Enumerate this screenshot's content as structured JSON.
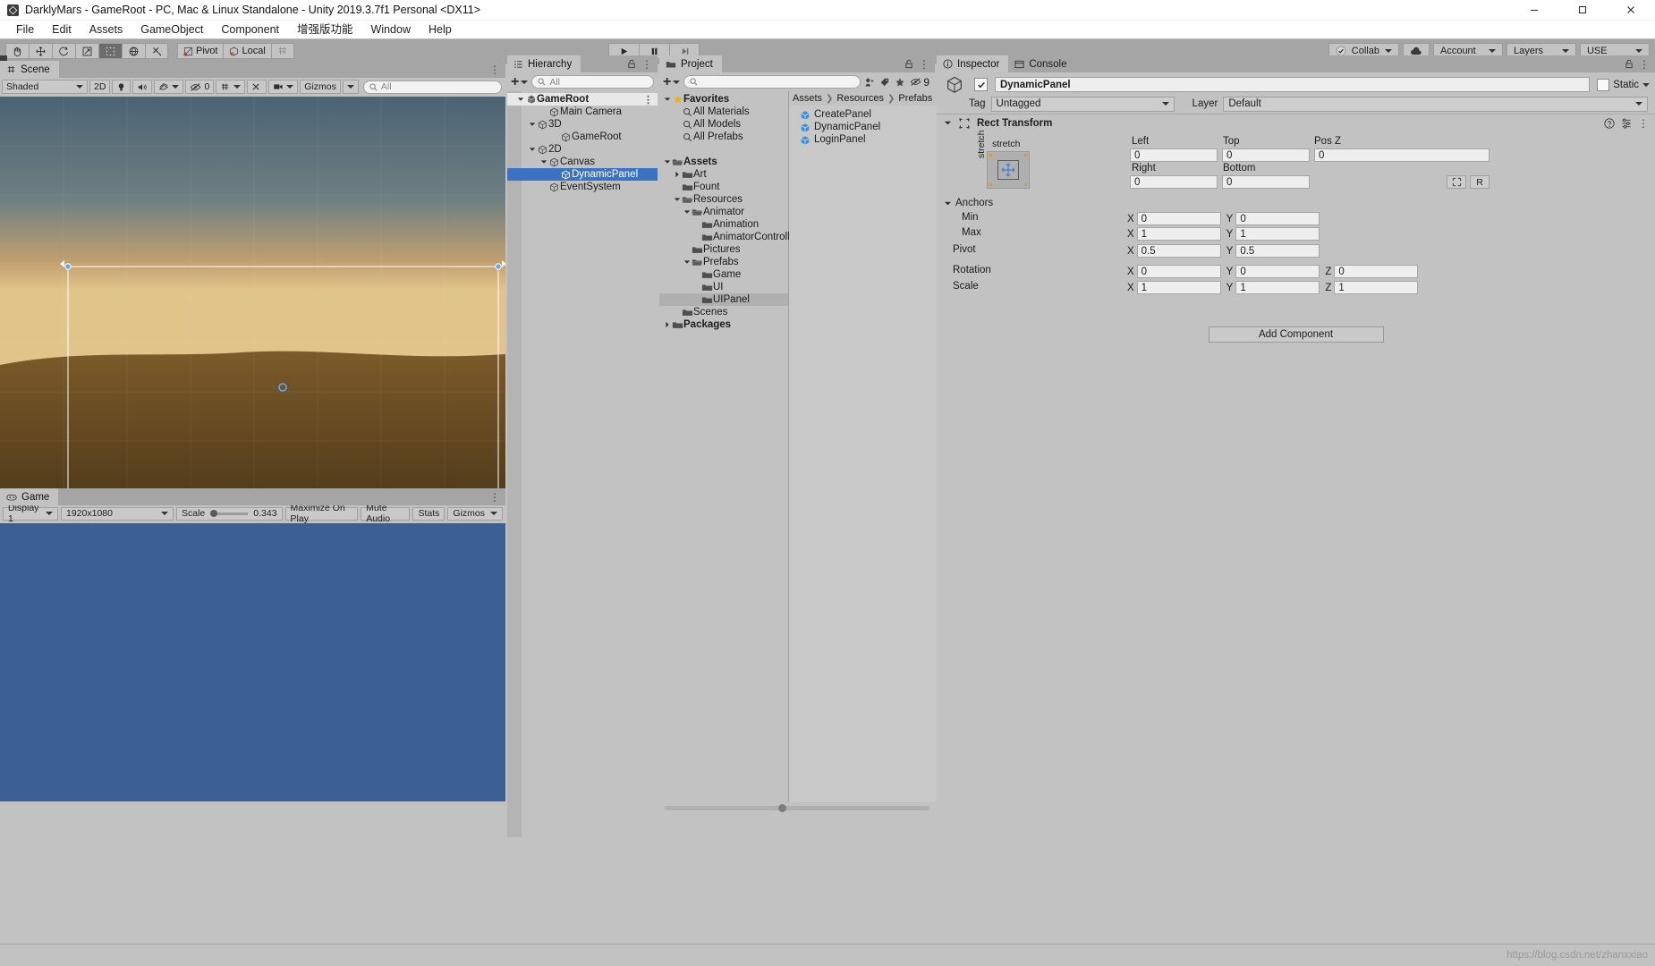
{
  "window": {
    "title": "DarklyMars - GameRoot - PC, Mac & Linux Standalone - Unity 2019.3.7f1 Personal <DX11>",
    "app_icon": "unity-icon",
    "controls": {
      "minimize": "minimize-icon",
      "maximize": "maximize-icon",
      "close": "close-icon"
    }
  },
  "menubar": {
    "items": [
      "File",
      "Edit",
      "Assets",
      "GameObject",
      "Component",
      "增强版功能",
      "Window",
      "Help"
    ]
  },
  "toolbar": {
    "tools": [
      {
        "name": "hand-tool",
        "active": false
      },
      {
        "name": "move-tool",
        "active": false
      },
      {
        "name": "rotate-tool",
        "active": false
      },
      {
        "name": "scale-tool",
        "active": false
      },
      {
        "name": "rect-tool",
        "active": true
      },
      {
        "name": "transform-tool",
        "active": false
      },
      {
        "name": "custom-tool",
        "active": false
      }
    ],
    "pivot_label": "Pivot",
    "local_label": "Local",
    "grid_label": "",
    "play_label": "play-icon",
    "pause_label": "pause-icon",
    "step_label": "step-icon",
    "collab_label": "Collab",
    "cloud_label": "cloud-icon",
    "account_label": "Account",
    "layers_label": "Layers",
    "layout_label": "USE"
  },
  "scene": {
    "tab_label": "Scene",
    "shading_mode": "Shaded",
    "mode_2d": "2D",
    "lighting_icon": "light-icon",
    "audio_icon": "audio-icon",
    "fx_icon": "fx-icon",
    "hidden_count": "0",
    "grid_icon": "grid-icon",
    "tools_icon": "tools-icon",
    "camera_icon": "camera-icon",
    "gizmos_label": "Gizmos",
    "search_placeholder": "All"
  },
  "game": {
    "tab_label": "Game",
    "display": "Display 1",
    "resolution": "1920x1080",
    "scale_label": "Scale",
    "scale_value": "0.343",
    "maximize_label": "Maximize On Play",
    "mute_label": "Mute Audio",
    "stats_label": "Stats",
    "gizmos_label": "Gizmos"
  },
  "hierarchy": {
    "tab_label": "Hierarchy",
    "add_label": "+",
    "search_placeholder": "All",
    "tree": [
      {
        "label": "GameRoot",
        "depth": 0,
        "icon": "unity-scene-icon",
        "arrow": "down",
        "selected": false,
        "header": true
      },
      {
        "label": "Main Camera",
        "depth": 2,
        "icon": "cube-icon",
        "arrow": "none",
        "selected": false,
        "header": false
      },
      {
        "label": "3D",
        "depth": 1,
        "icon": "cube-icon",
        "arrow": "down",
        "selected": false,
        "header": false
      },
      {
        "label": "GameRoot",
        "depth": 3,
        "icon": "cube-icon",
        "arrow": "none",
        "selected": false,
        "header": false
      },
      {
        "label": "2D",
        "depth": 1,
        "icon": "cube-icon",
        "arrow": "down",
        "selected": false,
        "header": false
      },
      {
        "label": "Canvas",
        "depth": 2,
        "icon": "cube-icon",
        "arrow": "down",
        "selected": false,
        "header": false
      },
      {
        "label": "DynamicPanel",
        "depth": 3,
        "icon": "cube-icon",
        "arrow": "none",
        "selected": true,
        "header": false
      },
      {
        "label": "EventSystem",
        "depth": 2,
        "icon": "cube-icon",
        "arrow": "none",
        "selected": false,
        "header": false
      }
    ]
  },
  "project": {
    "tab_label": "Project",
    "add_label": "+",
    "search_placeholder": "",
    "icon_count": "9",
    "breadcrumb": [
      "Assets",
      "Resources",
      "Prefabs"
    ],
    "tree": [
      {
        "label": "Favorites",
        "depth": 0,
        "icon": "star-icon",
        "arrow": "down",
        "bold": true
      },
      {
        "label": "All Materials",
        "depth": 1,
        "icon": "search-icon",
        "arrow": "none",
        "bold": false
      },
      {
        "label": "All Models",
        "depth": 1,
        "icon": "search-icon",
        "arrow": "none",
        "bold": false
      },
      {
        "label": "All Prefabs",
        "depth": 1,
        "icon": "search-icon",
        "arrow": "none",
        "bold": false
      },
      {
        "label": "",
        "depth": 0,
        "icon": "none",
        "arrow": "none",
        "bold": false
      },
      {
        "label": "Assets",
        "depth": 0,
        "icon": "folder-open-icon",
        "arrow": "down",
        "bold": true
      },
      {
        "label": "Art",
        "depth": 1,
        "icon": "folder-icon",
        "arrow": "right",
        "bold": false
      },
      {
        "label": "Fount",
        "depth": 1,
        "icon": "folder-icon",
        "arrow": "none",
        "bold": false
      },
      {
        "label": "Resources",
        "depth": 1,
        "icon": "folder-open-icon",
        "arrow": "down",
        "bold": false
      },
      {
        "label": "Animator",
        "depth": 2,
        "icon": "folder-open-icon",
        "arrow": "down",
        "bold": false
      },
      {
        "label": "Animation",
        "depth": 3,
        "icon": "folder-icon",
        "arrow": "none",
        "bold": false
      },
      {
        "label": "AnimatorControll",
        "depth": 3,
        "icon": "folder-icon",
        "arrow": "none",
        "bold": false
      },
      {
        "label": "Pictures",
        "depth": 2,
        "icon": "folder-icon",
        "arrow": "none",
        "bold": false
      },
      {
        "label": "Prefabs",
        "depth": 2,
        "icon": "folder-open-icon",
        "arrow": "down",
        "bold": false
      },
      {
        "label": "Game",
        "depth": 3,
        "icon": "folder-icon",
        "arrow": "none",
        "bold": false
      },
      {
        "label": "UI",
        "depth": 3,
        "icon": "folder-icon",
        "arrow": "none",
        "bold": false
      },
      {
        "label": "UIPanel",
        "depth": 3,
        "icon": "folder-icon",
        "arrow": "none",
        "bold": false,
        "selected": true
      },
      {
        "label": "Scenes",
        "depth": 1,
        "icon": "folder-icon",
        "arrow": "none",
        "bold": false
      },
      {
        "label": "Packages",
        "depth": 0,
        "icon": "folder-icon",
        "arrow": "right",
        "bold": true
      }
    ],
    "assets": [
      {
        "label": "CreatePanel",
        "icon": "prefab-icon"
      },
      {
        "label": "DynamicPanel",
        "icon": "prefab-icon"
      },
      {
        "label": "LoginPanel",
        "icon": "prefab-icon"
      }
    ]
  },
  "inspector": {
    "tab_label": "Inspector",
    "console_tab_label": "Console",
    "object_icon": "gameobject-icon",
    "enabled": true,
    "object_name": "DynamicPanel",
    "static_label": "Static",
    "tag_label": "Tag",
    "tag_value": "Untagged",
    "layer_label": "Layer",
    "layer_value": "Default",
    "component": {
      "title": "Rect Transform",
      "help_icon": "help-icon",
      "preset_icon": "preset-icon",
      "menu_icon": "kebab-icon",
      "anchor_preset_label": "stretch",
      "anchor_preset_label_v": "stretch",
      "fields": {
        "left_label": "Left",
        "left_value": "0",
        "top_label": "Top",
        "top_value": "0",
        "posz_label": "Pos Z",
        "posz_value": "0",
        "right_label": "Right",
        "right_value": "0",
        "bottom_label": "Bottom",
        "bottom_value": "0",
        "blueprint_icon": "blueprint-icon",
        "raw_label": "R"
      },
      "anchors_label": "Anchors",
      "min_label": "Min",
      "min_x": "0",
      "min_y": "0",
      "max_label": "Max",
      "max_x": "1",
      "max_y": "1",
      "pivot_label": "Pivot",
      "pivot_x": "0.5",
      "pivot_y": "0.5",
      "rotation_label": "Rotation",
      "rot_x": "0",
      "rot_y": "0",
      "rot_z": "0",
      "scale_label": "Scale",
      "scale_x": "1",
      "scale_y": "1",
      "scale_z": "1",
      "axis_x": "X",
      "axis_y": "Y",
      "axis_z": "Z"
    },
    "add_component_label": "Add Component"
  },
  "watermark": "https://blog.csdn.net/zhanxxiao",
  "colors": {
    "accent_selection": "#3a72c4",
    "panel_bg": "#c2c2c2",
    "toolbar_bg": "#a5a5a5",
    "game_bg": "#3c5f96"
  }
}
